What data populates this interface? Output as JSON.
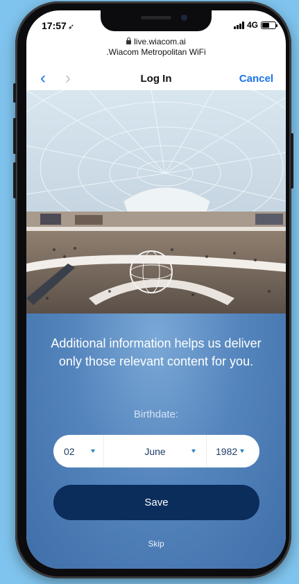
{
  "status_bar": {
    "time": "17:57",
    "location_icon": "location-arrow-icon",
    "network": "4G",
    "signal_icon": "signal-bars-icon",
    "battery_icon": "battery-icon",
    "battery_level": 0.55
  },
  "browser": {
    "url": "live.wiacom.ai",
    "network_name": ".Wiacom Metropolitan WiFi",
    "lock_icon": "lock-icon"
  },
  "nav": {
    "title": "Log In",
    "back_icon": "chevron-left-icon",
    "forward_icon": "chevron-right-icon",
    "cancel_label": "Cancel"
  },
  "hero": {
    "image": "shopping-mall-glass-dome-photo"
  },
  "form": {
    "info_text": "Additional information helps us deliver only those relevant content for you.",
    "birthdate_label": "Birthdate:",
    "birthdate": {
      "day": "02",
      "month": "June",
      "year": "1982"
    },
    "save_label": "Save",
    "skip_label": "Skip"
  },
  "colors": {
    "accent": "#1a73e8",
    "panel": "#4f7fb8",
    "save_button": "#0b2d5c",
    "caret": "#2a7fb8",
    "background": "#7fc4ee"
  }
}
